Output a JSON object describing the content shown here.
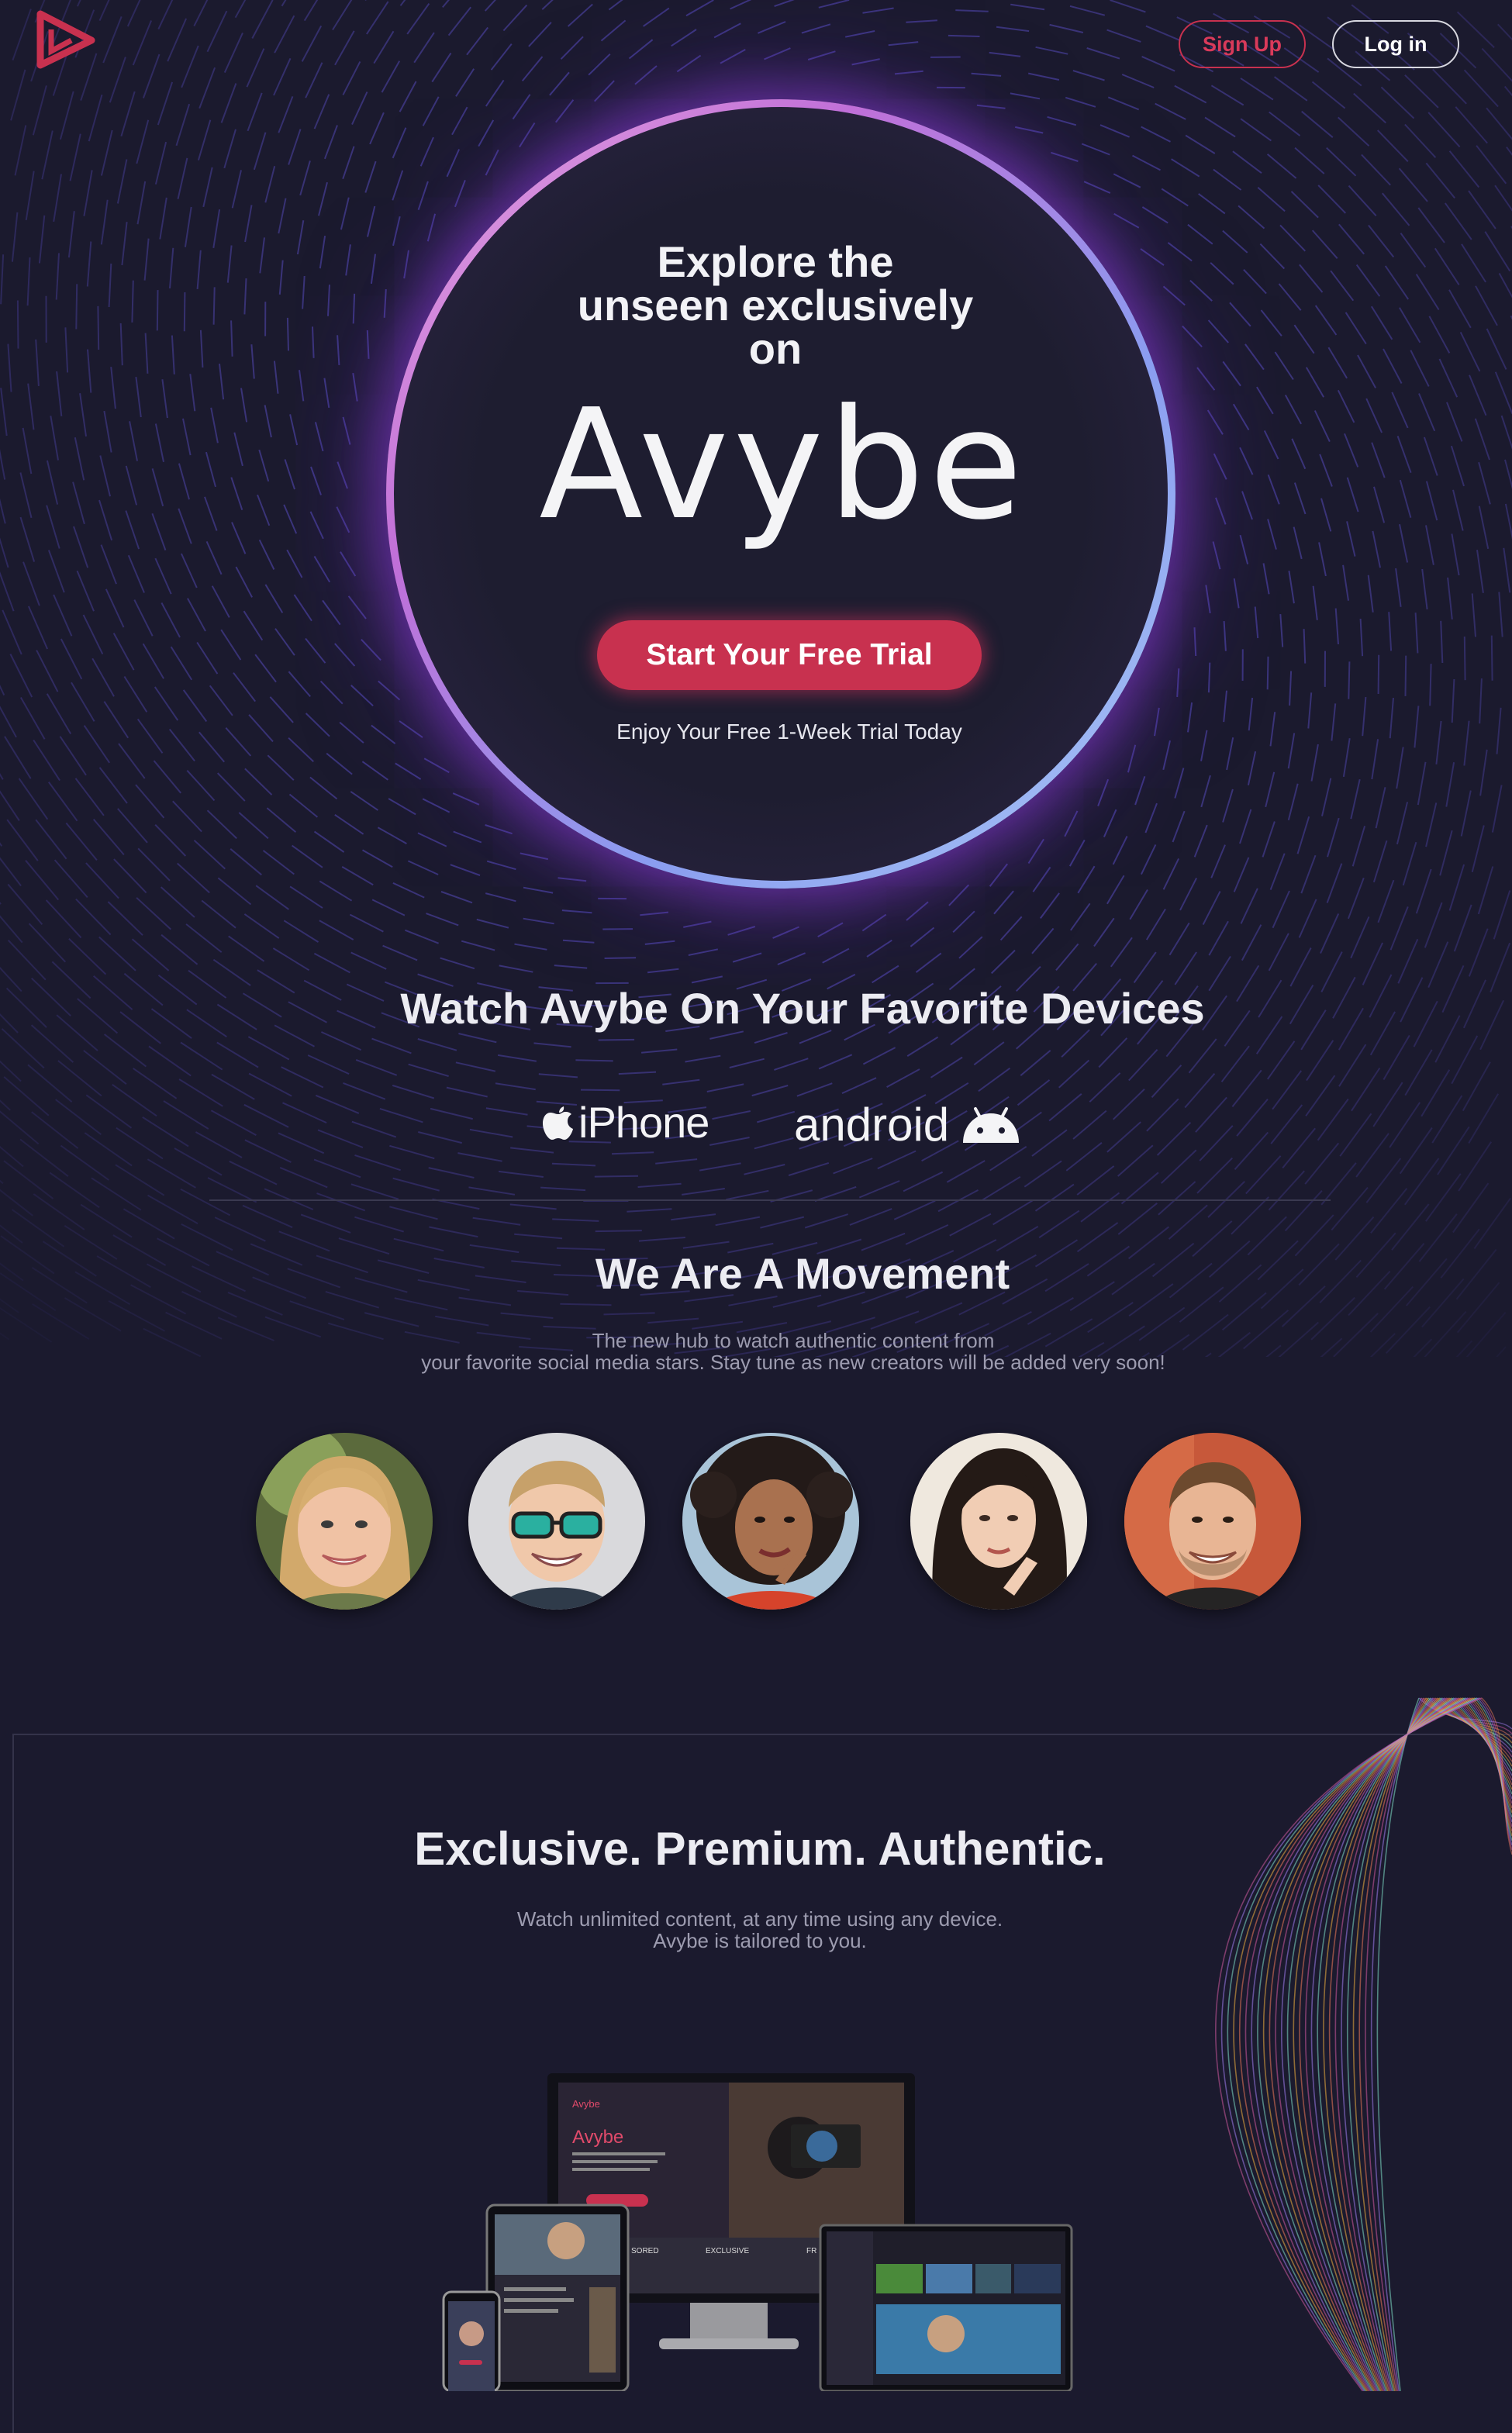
{
  "header": {
    "signup_label": "Sign Up",
    "login_label": "Log in"
  },
  "hero": {
    "heading_line1": "Explore the",
    "heading_line2": "unseen exclusively",
    "heading_line3": "on",
    "brand": "Avybe",
    "cta_label": "Start Your Free Trial",
    "note": "Enjoy Your Free 1-Week Trial Today"
  },
  "devices": {
    "title": "Watch Avybe On Your Favorite Devices",
    "iphone_label": "iPhone",
    "android_label": "android"
  },
  "movement": {
    "title": "We Are A Movement",
    "line1": "The new hub to watch authentic content from",
    "line2": "your favorite social media stars. Stay tune as new creators will be added very soon!",
    "creators": [
      {
        "name": "creator-1"
      },
      {
        "name": "creator-2"
      },
      {
        "name": "creator-3"
      },
      {
        "name": "creator-4"
      },
      {
        "name": "creator-5"
      }
    ]
  },
  "exclusive": {
    "title": "Exclusive. Premium. Authentic.",
    "line1": "Watch unlimited content, at any time using any device.",
    "line2": "Avybe is tailored to you."
  },
  "mockup": {
    "app_name": "Avybe",
    "heading": "Avybe",
    "col1": "SORED",
    "col2": "EXCLUSIVE",
    "col3": "FR"
  },
  "colors": {
    "background": "#1b1a2e",
    "accent": "#c8314f",
    "ring_start": "#e9a8e0",
    "ring_end": "#a9c8f5"
  }
}
